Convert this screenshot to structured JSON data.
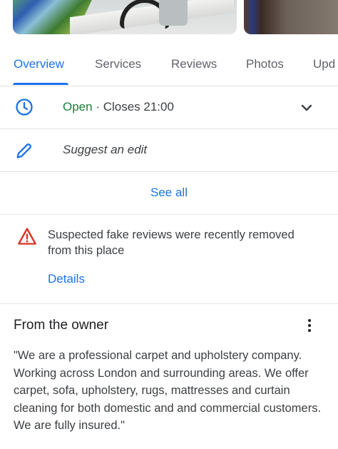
{
  "tabs": [
    {
      "label": "Overview",
      "active": true
    },
    {
      "label": "Services",
      "active": false
    },
    {
      "label": "Reviews",
      "active": false
    },
    {
      "label": "Photos",
      "active": false
    },
    {
      "label": "Upd",
      "active": false
    }
  ],
  "hours": {
    "status": "Open",
    "separator": " · ",
    "closes": "Closes 21:00"
  },
  "edit": {
    "label": "Suggest an edit"
  },
  "see_all": {
    "label": "See all"
  },
  "warning": {
    "text": "Suspected fake reviews were recently removed from this place",
    "link": "Details"
  },
  "owner": {
    "title": "From the owner",
    "quote": "\"We are a professional carpet and upholstery company. Working across London and surrounding areas. We offer carpet, sofa, upholstery, rugs, mattresses and curtain cleaning for both domestic and and commercial customers. We are fully insured.\""
  },
  "icons": {
    "hours": "clock-icon",
    "edit": "pencil-icon",
    "expand": "chevron-down-icon",
    "warning": "warning-triangle-icon",
    "menu": "more-vert-icon"
  },
  "colors": {
    "accent": "#1a73e8",
    "open": "#188038",
    "warning": "#d93025",
    "text": "#3c4043"
  }
}
